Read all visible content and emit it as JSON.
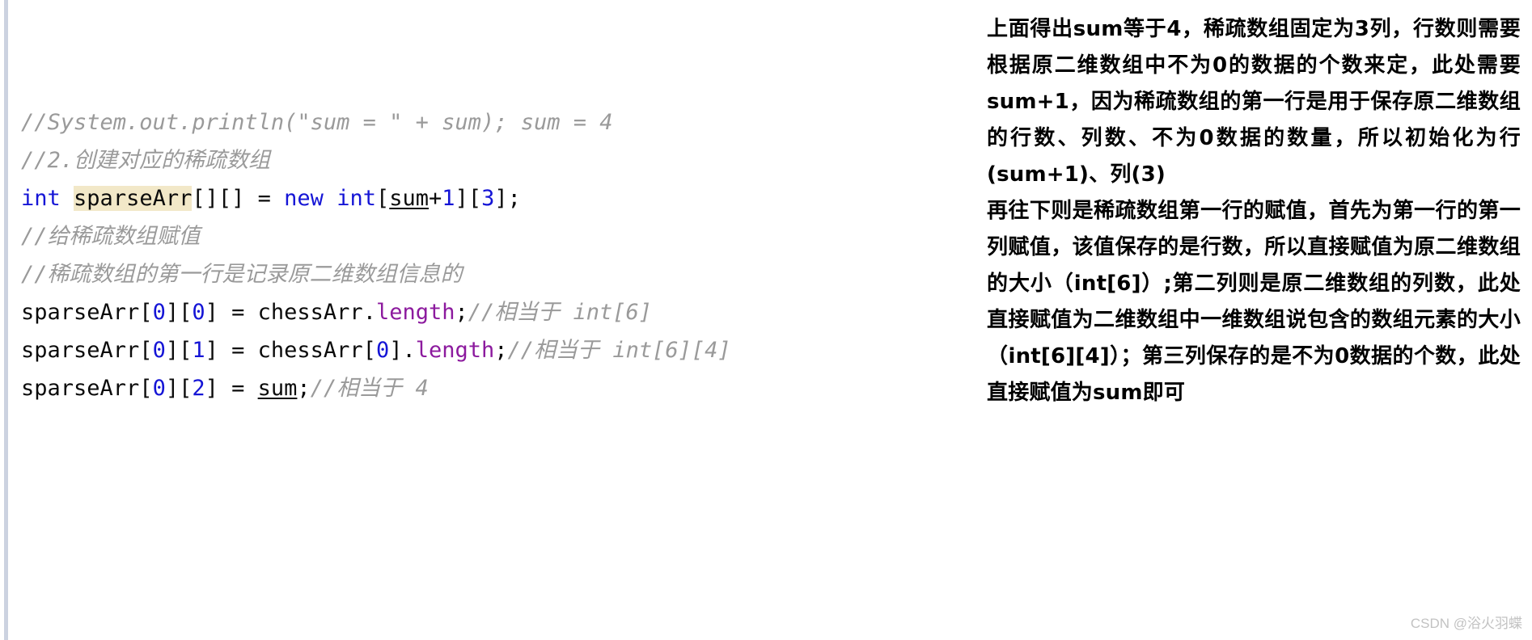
{
  "code_panel": {
    "language": "java",
    "highlight_color": "#f2e8c8",
    "gutter_color": "#ccd2e0",
    "lines": [
      {
        "id": "line-1",
        "tokens": [
          {
            "t": "//System.out.println(\"sum = \" + sum); sum = 4",
            "c": "cm"
          }
        ]
      },
      {
        "id": "line-2",
        "tokens": [
          {
            "t": "//2.创建对应的稀疏数组",
            "c": "cm"
          }
        ]
      },
      {
        "id": "line-3",
        "tokens": [
          {
            "t": "int",
            "c": "kw"
          },
          {
            "t": " ",
            "c": "plain"
          },
          {
            "t": "sparseArr",
            "c": "plain hl"
          },
          {
            "t": "[][] = ",
            "c": "plain"
          },
          {
            "t": "new",
            "c": "kw"
          },
          {
            "t": " ",
            "c": "plain"
          },
          {
            "t": "int",
            "c": "kw"
          },
          {
            "t": "[",
            "c": "plain"
          },
          {
            "t": "sum",
            "c": "plain udl"
          },
          {
            "t": "+",
            "c": "plain"
          },
          {
            "t": "1",
            "c": "num"
          },
          {
            "t": "][",
            "c": "plain"
          },
          {
            "t": "3",
            "c": "num"
          },
          {
            "t": "];",
            "c": "plain"
          }
        ]
      },
      {
        "id": "line-4",
        "tokens": [
          {
            "t": "//给稀疏数组赋值",
            "c": "cm"
          }
        ]
      },
      {
        "id": "line-5",
        "tokens": [
          {
            "t": "//稀疏数组的第一行是记录原二维数组信息的",
            "c": "cm"
          }
        ]
      },
      {
        "id": "line-6",
        "tokens": [
          {
            "t": "sparseArr[",
            "c": "plain"
          },
          {
            "t": "0",
            "c": "num"
          },
          {
            "t": "][",
            "c": "plain"
          },
          {
            "t": "0",
            "c": "num"
          },
          {
            "t": "] = chessArr",
            "c": "plain"
          },
          {
            "t": ".",
            "c": "plain"
          },
          {
            "t": "length",
            "c": "mem"
          },
          {
            "t": ";",
            "c": "plain"
          },
          {
            "t": "//相当于 int[6]",
            "c": "cm"
          }
        ]
      },
      {
        "id": "line-7",
        "tokens": [
          {
            "t": "sparseArr[",
            "c": "plain"
          },
          {
            "t": "0",
            "c": "num"
          },
          {
            "t": "][",
            "c": "plain"
          },
          {
            "t": "1",
            "c": "num"
          },
          {
            "t": "] = chessArr[",
            "c": "plain"
          },
          {
            "t": "0",
            "c": "num"
          },
          {
            "t": "]",
            "c": "plain"
          },
          {
            "t": ".",
            "c": "plain"
          },
          {
            "t": "length",
            "c": "mem"
          },
          {
            "t": ";",
            "c": "plain"
          },
          {
            "t": "//相当于 int[6][4]",
            "c": "cm"
          }
        ]
      },
      {
        "id": "line-8",
        "tokens": [
          {
            "t": "sparseArr[",
            "c": "plain"
          },
          {
            "t": "0",
            "c": "num"
          },
          {
            "t": "][",
            "c": "plain"
          },
          {
            "t": "2",
            "c": "num"
          },
          {
            "t": "] = ",
            "c": "plain"
          },
          {
            "t": "sum",
            "c": "plain udl"
          },
          {
            "t": ";",
            "c": "plain"
          },
          {
            "t": "//相当于 4",
            "c": "cm"
          }
        ]
      }
    ]
  },
  "notes_panel": {
    "paragraphs": [
      {
        "id": "note-1",
        "text": "上面得出sum等于4，稀疏数组固定为3列，行数则需要根据原二维数组中不为0的数据的个数来定，此处需要sum+1，因为稀疏数组的第一行是用于保存原二维数组的行数、列数、不为0数据的数量，所以初始化为行(sum+1)、列(3)"
      },
      {
        "id": "note-2",
        "text": "再往下则是稀疏数组第一行的赋值，首先为第一行的第一列赋值，该值保存的是行数，所以直接赋值为原二维数组的大小（int[6]）;第二列则是原二维数组的列数，此处直接赋值为二维数组中一维数组说包含的数组元素的大小（int[6][4]）；第三列保存的是不为0数据的个数，此处直接赋值为sum即可"
      }
    ]
  },
  "watermark": {
    "text": "CSDN @浴火羽蝶"
  }
}
